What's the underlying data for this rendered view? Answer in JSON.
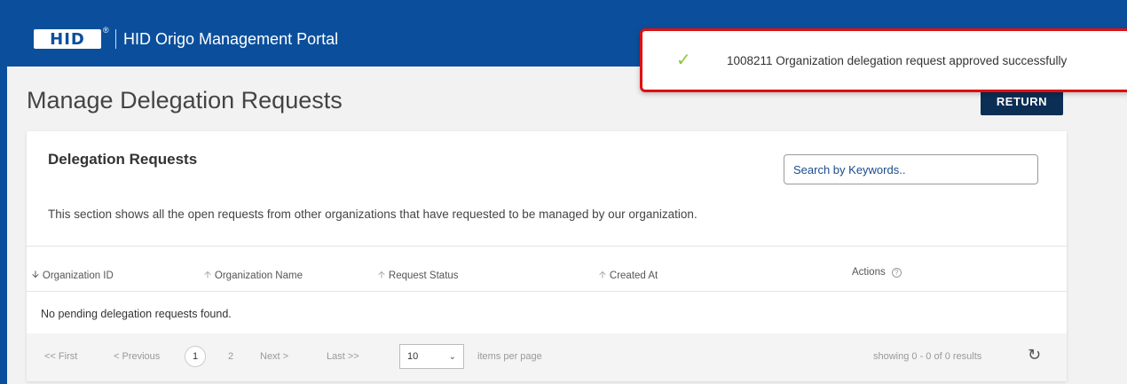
{
  "header": {
    "logo_text": "HID",
    "logo_mark": "®",
    "portal_title": "HID Origo Management Portal"
  },
  "page": {
    "title": "Manage Delegation Requests",
    "return_label": "RETURN"
  },
  "card": {
    "title": "Delegation Requests",
    "search_placeholder": "Search by Keywords..",
    "description": "This section shows all the open requests from other organizations that have requested to be managed by our organization."
  },
  "table": {
    "columns": [
      {
        "label": "Organization ID",
        "sort_icon": "arrow-down-icon",
        "active": true
      },
      {
        "label": "Organization Name",
        "sort_icon": "arrow-up-icon",
        "active": false
      },
      {
        "label": "Request Status",
        "sort_icon": "arrow-up-icon",
        "active": false
      },
      {
        "label": "Created At",
        "sort_icon": "arrow-up-icon",
        "active": false
      },
      {
        "label": "Actions",
        "sort_icon": "",
        "active": false
      }
    ],
    "empty_message": "No pending delegation requests found."
  },
  "pagination": {
    "first": "<< First",
    "previous": "< Previous",
    "pages": [
      "1",
      "2"
    ],
    "current_page": "1",
    "next": "Next >",
    "last": "Last >>",
    "page_size": "10",
    "items_per_page": "items per page",
    "summary": "showing 0 - 0 of 0 results"
  },
  "toast": {
    "message": "1008211 Organization delegation request approved successfully",
    "icon": "check-icon"
  },
  "colors": {
    "brand_blue": "#0b4f9c",
    "button_dark": "#0b2e55",
    "toast_border": "#e01010",
    "success_check": "#8dc63f"
  }
}
